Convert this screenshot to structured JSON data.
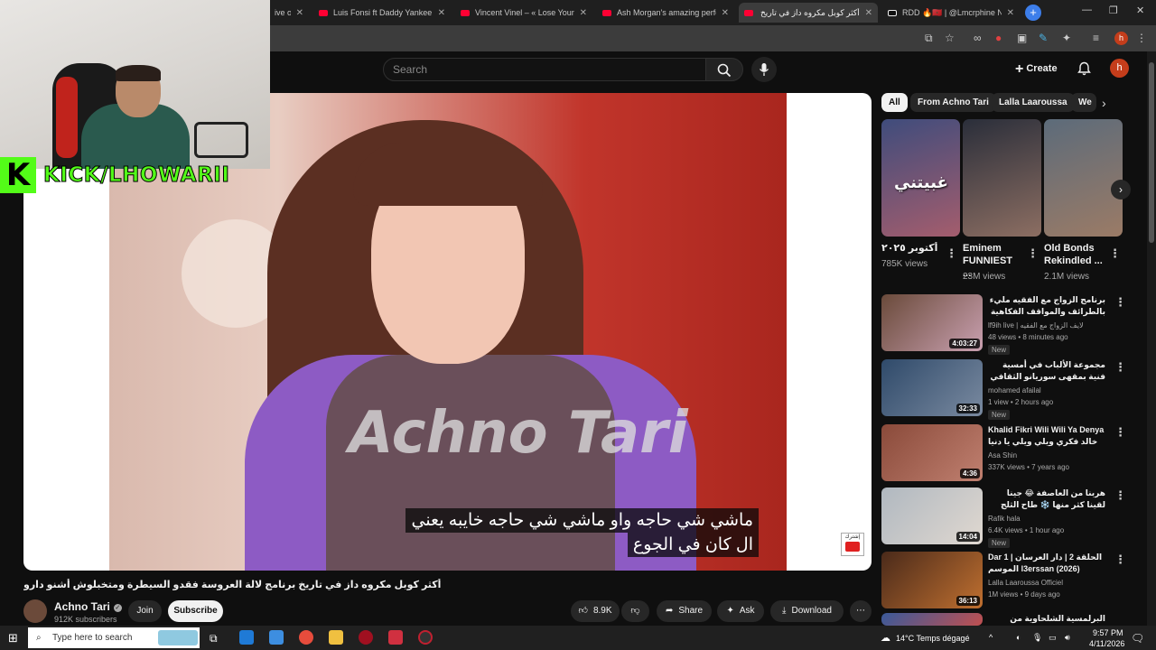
{
  "browser": {
    "tabs": [
      {
        "title": "ive o"
      },
      {
        "title": "Luis Fonsi ft Daddy Yankee – D"
      },
      {
        "title": "Vincent Vinel – « Lose Yourself"
      },
      {
        "title": "Ash Morgan's amazing perform"
      },
      {
        "title": "أكثر كوبل مكروه داز في تاريخ"
      },
      {
        "title": "RDD 🔥🇲🇦 | @Lmcrphine Next"
      }
    ],
    "new_tab_label": "+",
    "profile_initial": "h"
  },
  "youtube": {
    "search_placeholder": "Search",
    "create_label": "Create",
    "avatar_initial": "h"
  },
  "stream_overlay": {
    "kick_logo": "K",
    "kick_handle": "KICK/LHOWARII"
  },
  "video": {
    "watermark": "Achno Tari",
    "subtitle_line1": "ماشي شي حاجه واو ماشي شي حاجه خايبه يعني",
    "subtitle_line2": "ال كان في الجوع",
    "title": "أكثر كوبل مكروه داز في تاريخ برنامج لالة العروسة فقدو السيطرة ومتخبلوش أشنو دارو",
    "channel_name": "Achno Tari",
    "channel_subs": "912K subscribers",
    "join_label": "Join",
    "subscribe_label": "Subscribe",
    "likes": "8.9K",
    "share_label": "Share",
    "ask_label": "Ask",
    "download_label": "Download",
    "subscribe_badge": "إشترك"
  },
  "chips": [
    "All",
    "From Achno Tari",
    "Lalla Laaroussa",
    "We"
  ],
  "shorts": [
    {
      "title": "١ أكتوبر ٢٠٢٥",
      "views": "785K views",
      "overlay_text": "غبيتني",
      "colors": [
        "#3f4c7c",
        "#a45d6d"
      ]
    },
    {
      "title": "Eminem FUNNIEST ...",
      "views": "23M views",
      "colors": [
        "#2a2e3a",
        "#8c6e62"
      ]
    },
    {
      "title": "Old Bonds Rekindled ...",
      "views": "2.1M views",
      "colors": [
        "#5c6b7a",
        "#9b7b66"
      ]
    }
  ],
  "recommendations": [
    {
      "title": "برنامج الزواج مع الفقيه مليء بالطرائف والمواقف الفكاهية",
      "channel": "lf9ih live | لايف الزواج مع الفقيه",
      "meta": "48 views • 8 minutes ago",
      "duration": "4:03:27",
      "badge": "New",
      "rtl": true,
      "colors": [
        "#6a4a3a",
        "#c9a0b0"
      ]
    },
    {
      "title": "مجموعة الألباب في أمسية فنية بمقهى سوريانو الثقافي تطوان",
      "channel": "mohamed afailal",
      "meta": "1 view • 2 hours ago",
      "duration": "32:33",
      "badge": "New",
      "rtl": true,
      "colors": [
        "#2f4a6a",
        "#7a8aa0"
      ]
    },
    {
      "title": "Khalid Fikri Wili Wili Ya Denya خالد فكري ويلي ويلي يا دنيا",
      "channel": "Asa Shin",
      "meta": "337K views • 7 years ago",
      "duration": "4:36",
      "badge": "",
      "rtl": false,
      "colors": [
        "#8a4a3a",
        "#c08070"
      ]
    },
    {
      "title": "هربنا من العاصفة 😂 جينا لقينا كثر منها ❄️ طاح الثلج فمراكش",
      "channel": "Rafik hala",
      "meta": "6.4K views • 1 hour ago",
      "duration": "14:04",
      "badge": "New",
      "rtl": true,
      "colors": [
        "#b0b8c0",
        "#e0d8d0"
      ]
    },
    {
      "title": "Dar 1 | الحلقة 2 | دار العرسان الموسم l3erssan (2026)",
      "channel": "Lalla Laaroussa Officiel",
      "meta": "1M views • 9 days ago",
      "duration": "36:13",
      "badge": "",
      "rtl": false,
      "colors": [
        "#4a2a1a",
        "#c07030"
      ]
    },
    {
      "title": "البرلمسية الشلحاوية من الثورة الثالثة",
      "channel": "",
      "meta": "",
      "duration": "",
      "badge": "",
      "rtl": true,
      "colors": [
        "#3a5a9a",
        "#c05050"
      ]
    }
  ],
  "taskbar": {
    "search_placeholder": "Type here to search",
    "weather": "14°C  Temps dégagé",
    "time": "9:57 PM",
    "date": "4/11/2026"
  }
}
